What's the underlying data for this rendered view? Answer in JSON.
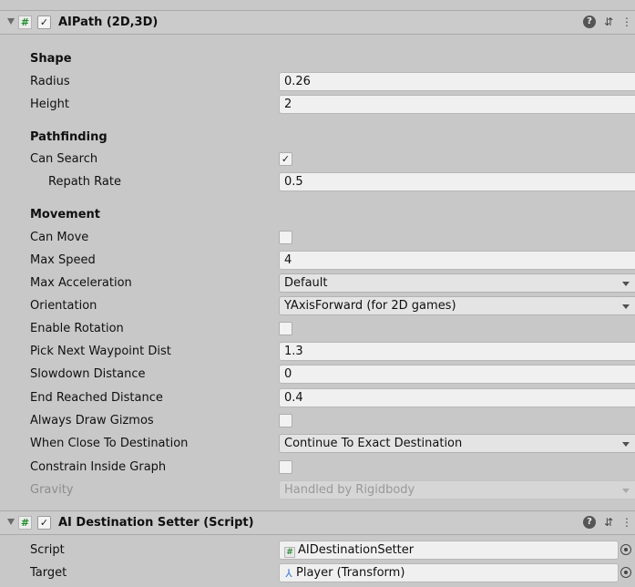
{
  "components": [
    {
      "title": "AIPath (2D,3D)",
      "enabled_glyph": "✓",
      "script_glyph": "#",
      "icons": [
        "help-icon",
        "preset-icon",
        "menu-icon"
      ]
    },
    {
      "title": "AI Destination Setter (Script)",
      "enabled_glyph": "✓",
      "script_glyph": "#",
      "icons": [
        "help-icon",
        "preset-icon",
        "menu-icon"
      ]
    }
  ],
  "icon_glyphs": {
    "help": "?",
    "preset": "⇵",
    "menu": "⋮"
  },
  "sections": {
    "shape": "Shape",
    "pathfinding": "Pathfinding",
    "movement": "Movement"
  },
  "fields": {
    "radius": {
      "label": "Radius",
      "value": "0.26"
    },
    "height": {
      "label": "Height",
      "value": "2"
    },
    "can_search": {
      "label": "Can Search",
      "checked": true,
      "glyph": "✓"
    },
    "repath_rate": {
      "label": "Repath Rate",
      "value": "0.5"
    },
    "can_move": {
      "label": "Can Move",
      "checked": false
    },
    "max_speed": {
      "label": "Max Speed",
      "value": "4"
    },
    "max_acceleration": {
      "label": "Max Acceleration",
      "value": "Default"
    },
    "orientation": {
      "label": "Orientation",
      "value": "YAxisForward (for 2D games)"
    },
    "enable_rotation": {
      "label": "Enable Rotation",
      "checked": false
    },
    "pick_next_waypoint_dist": {
      "label": "Pick Next Waypoint Dist",
      "value": "1.3"
    },
    "slowdown_distance": {
      "label": "Slowdown Distance",
      "value": "0"
    },
    "end_reached_distance": {
      "label": "End Reached Distance",
      "value": "0.4"
    },
    "always_draw_gizmos": {
      "label": "Always Draw Gizmos",
      "checked": false
    },
    "when_close_to_destination": {
      "label": "When Close To Destination",
      "value": "Continue To Exact Destination"
    },
    "constrain_inside_graph": {
      "label": "Constrain Inside Graph",
      "checked": false
    },
    "gravity": {
      "label": "Gravity",
      "value": "Handled by Rigidbody"
    },
    "script": {
      "label": "Script",
      "value": "AIDestinationSetter",
      "icon": "script-icon",
      "icon_glyph": "#"
    },
    "target": {
      "label": "Target",
      "value": "Player (Transform)",
      "icon": "transform-icon",
      "icon_glyph": "⅄"
    }
  }
}
